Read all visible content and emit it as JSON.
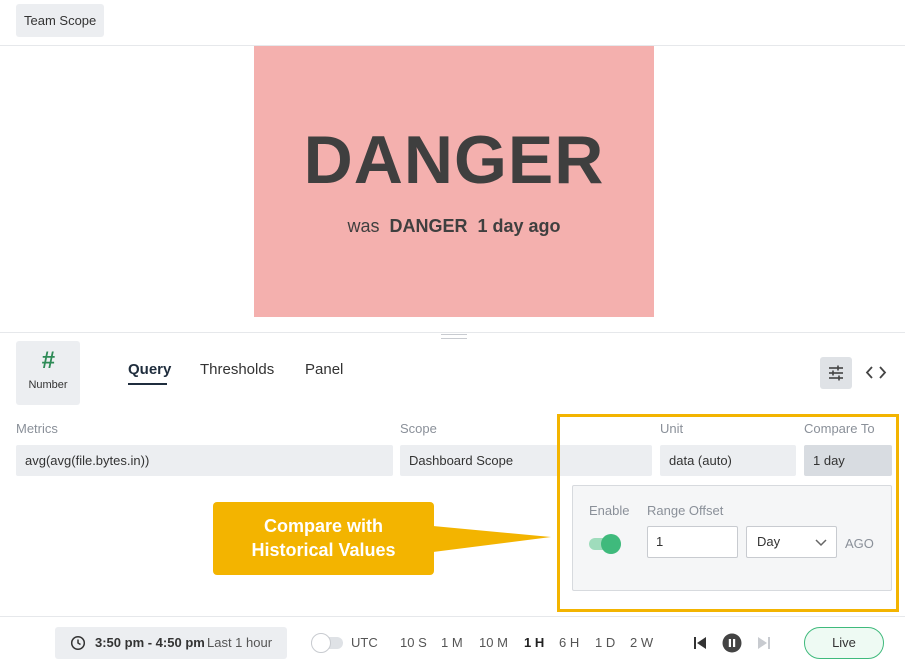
{
  "header": {
    "scope_chip": "Team Scope"
  },
  "preview": {
    "big_value": "DANGER",
    "compare_prefix": "was",
    "compare_value": "DANGER",
    "compare_ago": "1 day ago",
    "background_color": "#f4b0ae"
  },
  "visualization": {
    "icon": "hash-icon",
    "label": "Number"
  },
  "tabs": [
    {
      "label": "Query",
      "active": true
    },
    {
      "label": "Thresholds",
      "active": false
    },
    {
      "label": "Panel",
      "active": false
    }
  ],
  "toolbar": {
    "settings_icon": "sliders-icon",
    "code_icon": "code-brackets-icon"
  },
  "fields": {
    "metrics": {
      "label": "Metrics",
      "value": "avg(avg(file.bytes.in))"
    },
    "scope": {
      "label": "Scope",
      "value": "Dashboard Scope"
    },
    "unit": {
      "label": "Unit",
      "value": "data (auto)"
    },
    "compare_to": {
      "label": "Compare To",
      "value": "1 day"
    }
  },
  "compare_panel": {
    "enable_label": "Enable",
    "enabled": true,
    "range_offset_label": "Range Offset",
    "offset_value": "1",
    "offset_unit": "Day",
    "ago_label": "AGO"
  },
  "callout": {
    "line1": "Compare with",
    "line2": "Historical Values",
    "color": "#f3b400"
  },
  "time_bar": {
    "range": "3:50 pm - 4:50 pm",
    "last": "Last 1 hour",
    "utc_label": "UTC",
    "utc_enabled": false,
    "options": [
      "10 S",
      "1 M",
      "10 M",
      "1 H",
      "6 H",
      "1 D",
      "2 W"
    ],
    "active_option": "1 H",
    "live_label": "Live"
  },
  "colors": {
    "accent_green": "#3fba7c",
    "highlight": "#f3b400"
  }
}
